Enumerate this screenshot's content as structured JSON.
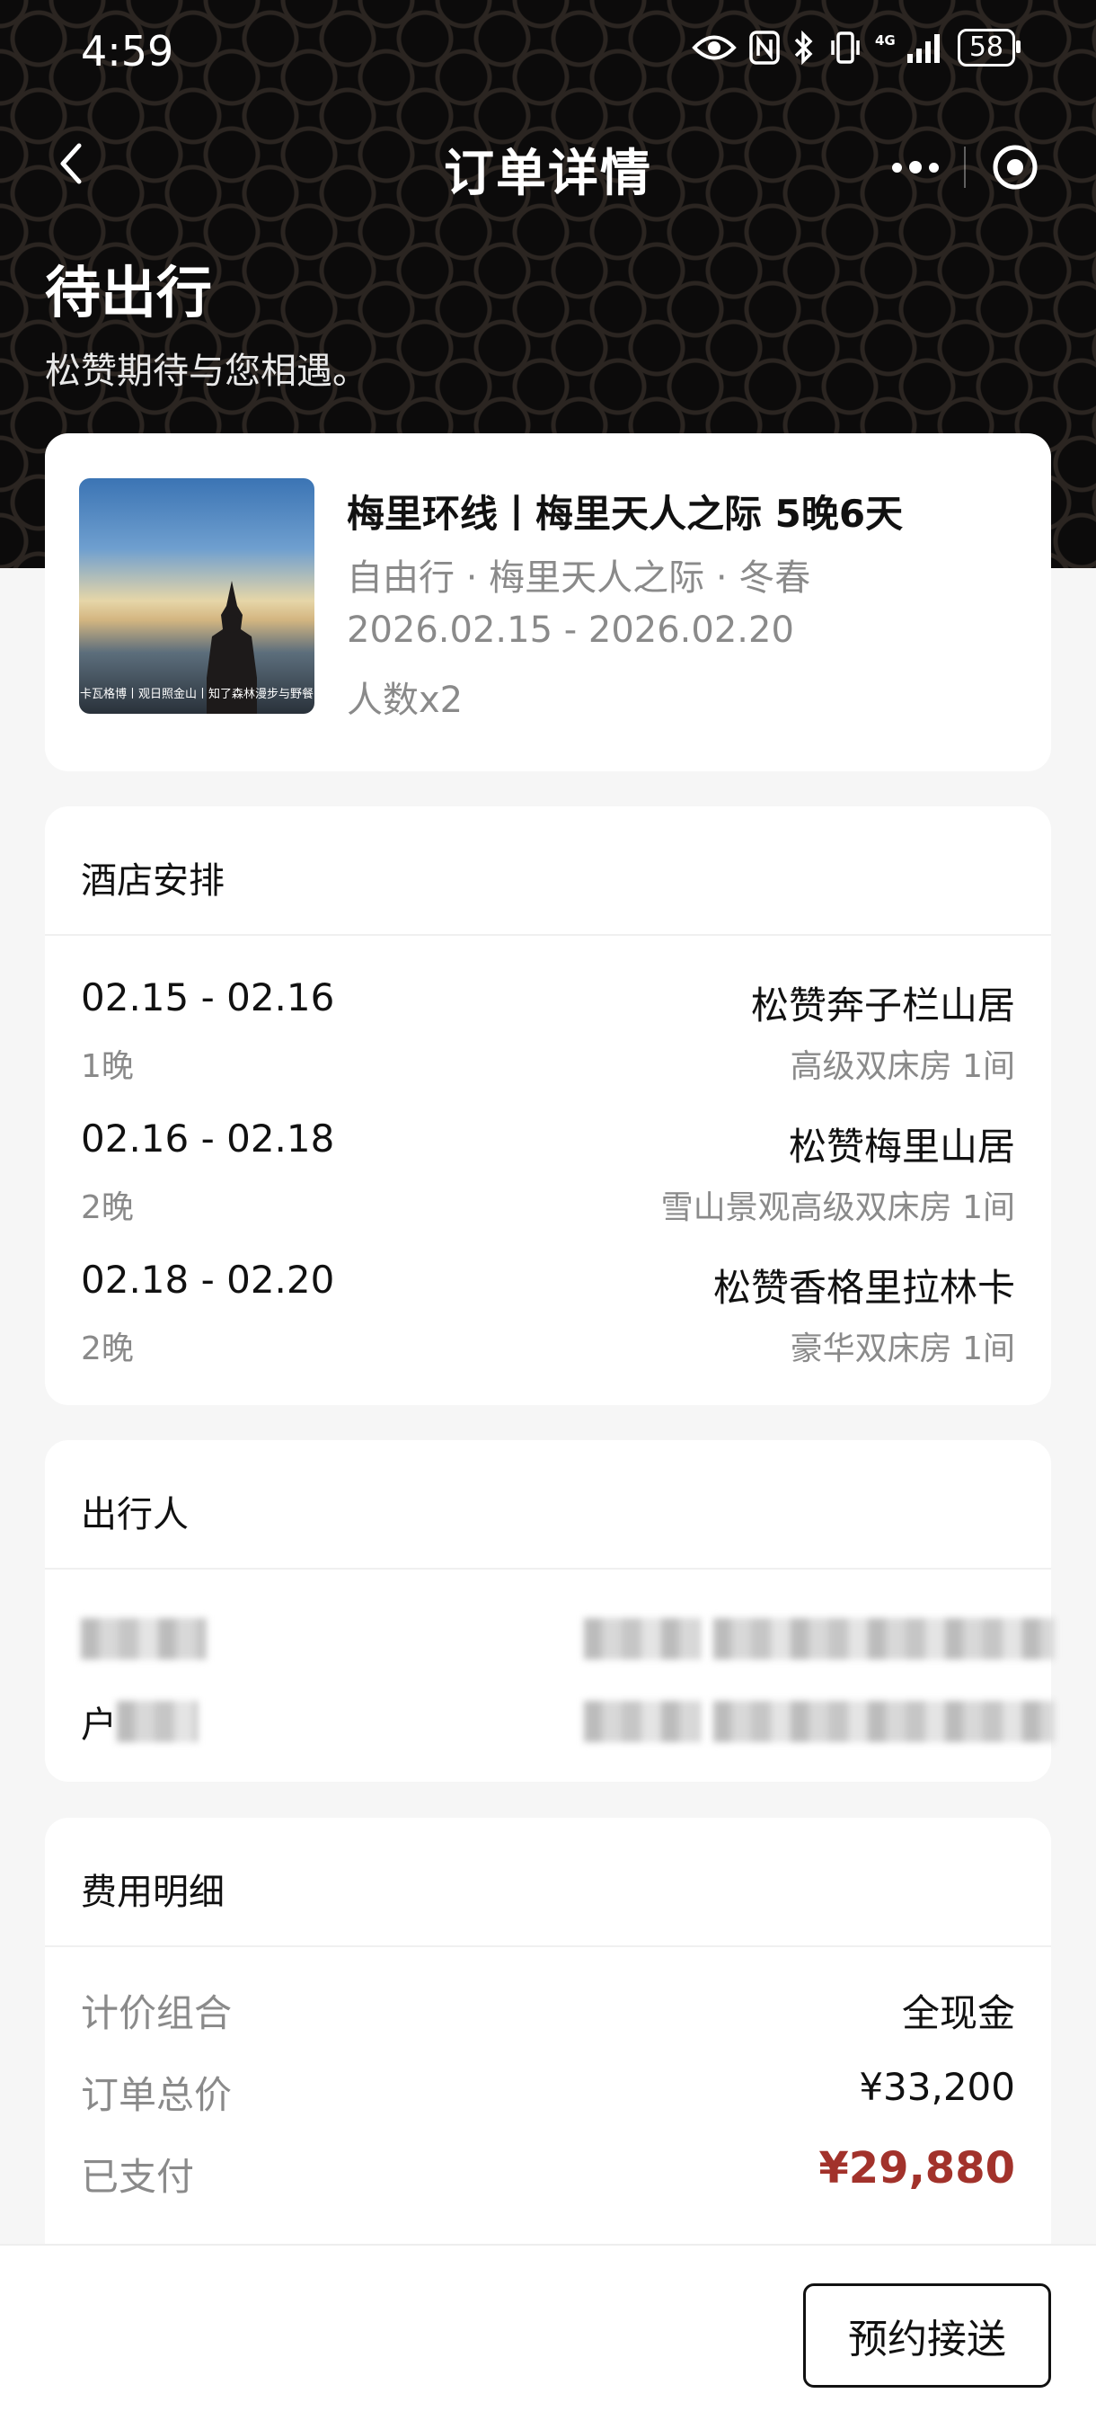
{
  "status_bar": {
    "time": "4:59",
    "battery": "58",
    "network": "4G"
  },
  "nav": {
    "title": "订单详情"
  },
  "order_status": {
    "title": "待出行",
    "subtitle": "松赞期待与您相遇。"
  },
  "product": {
    "title": "梅里环线丨梅里天人之际 5晚6天",
    "meta": "自由行 · 梅里天人之际 · 冬春",
    "dates": "2026.02.15 - 2026.02.20",
    "people": "人数x2",
    "image_caption": "卡瓦格博丨观日照金山丨知了森林漫步与野餐"
  },
  "hotels": {
    "section_title": "酒店安排",
    "items": [
      {
        "dates": "02.15 - 02.16",
        "nights": "1晚",
        "name": "松赞奔子栏山居",
        "room": "高级双床房 1间"
      },
      {
        "dates": "02.16 - 02.18",
        "nights": "2晚",
        "name": "松赞梅里山居",
        "room": "雪山景观高级双床房 1间"
      },
      {
        "dates": "02.18 - 02.20",
        "nights": "2晚",
        "name": "松赞香格里拉林卡",
        "room": "豪华双床房 1间"
      }
    ]
  },
  "travelers": {
    "section_title": "出行人",
    "items": [
      {
        "name": ""
      },
      {
        "name": "户"
      }
    ]
  },
  "fees": {
    "section_title": "费用明细",
    "rows": [
      {
        "label": "计价组合",
        "value": "全现金"
      },
      {
        "label": "订单总价",
        "value": "¥33,200"
      },
      {
        "label": "已支付",
        "value": "¥29,880"
      }
    ]
  },
  "actions": {
    "pickup_label": "预约接送"
  },
  "colors": {
    "accent_red": "#a2322b",
    "header_bg": "#0c0b0b"
  }
}
